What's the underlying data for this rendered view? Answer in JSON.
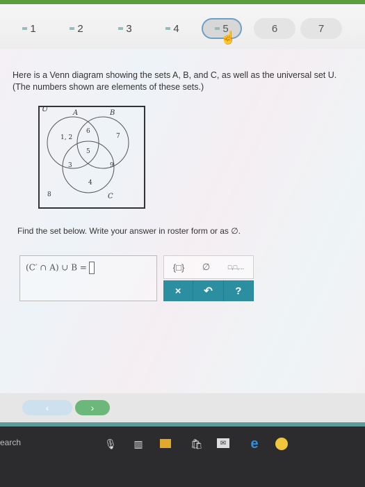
{
  "question_nav": {
    "items": [
      {
        "label": "1",
        "state": "done"
      },
      {
        "label": "2",
        "state": "done"
      },
      {
        "label": "3",
        "state": "done"
      },
      {
        "label": "4",
        "state": "done"
      },
      {
        "label": "5",
        "state": "current"
      },
      {
        "label": "6",
        "state": "unanswered"
      },
      {
        "label": "7",
        "state": "unanswered"
      }
    ]
  },
  "problem": {
    "intro_line1": "Here is a Venn diagram showing the sets A, B, and C, as well as the universal set U.",
    "intro_line2": "(The numbers shown are elements of these sets.)",
    "instruction": "Find the set below. Write your answer in roster form or as ∅."
  },
  "venn": {
    "universal_label": "U",
    "set_a_label": "A",
    "set_b_label": "B",
    "set_c_label": "C",
    "elements": {
      "a_only": "1, 2",
      "a_b_only": "6",
      "b_only": "7",
      "a_b_c": "5",
      "a_c_only": "3",
      "b_c_only": "9",
      "c_only": "4",
      "outside": "8"
    }
  },
  "answer": {
    "expression": "(C′ ∩ A) ∪ B ="
  },
  "tools": {
    "braces": "{□}",
    "empty_set": "∅",
    "list": "□,□,..."
  },
  "actions": {
    "clear": "×",
    "undo": "↶",
    "help": "?"
  },
  "bottom_nav": {
    "back": "‹",
    "next": "›"
  },
  "taskbar": {
    "search_text": "earch"
  },
  "colors": {
    "accent_green": "#5b9e3c",
    "action_teal": "#2b8fa1",
    "active_border": "#6e9fc7"
  }
}
